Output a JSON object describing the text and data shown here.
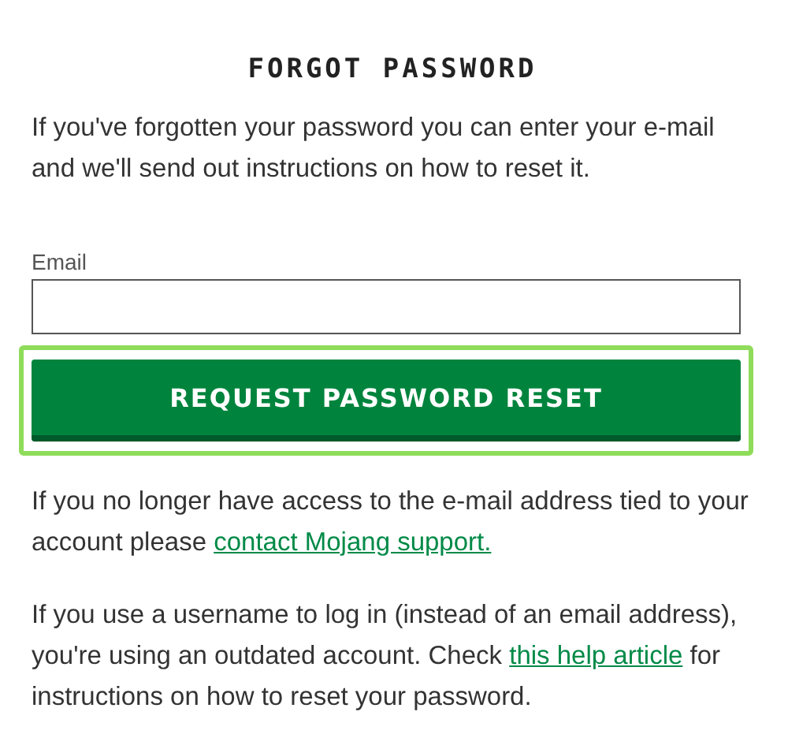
{
  "heading": "FORGOT PASSWORD",
  "intro": "If you've forgotten your password you can enter your e-mail and we'll send out instructions on how to reset it.",
  "email_field": {
    "label": "Email"
  },
  "submit_button": {
    "label": "REQUEST PASSWORD RESET",
    "highlighted": true
  },
  "support_note": {
    "text": "If you no longer have access to the e-mail address tied to your account please ",
    "link": "contact Mojang support."
  },
  "username_note": {
    "text_before": "If you use a username to log in (instead of an email address), you're using an outdated account. Check ",
    "link": "this help article",
    "text_after": " for instructions on how to reset your password."
  }
}
